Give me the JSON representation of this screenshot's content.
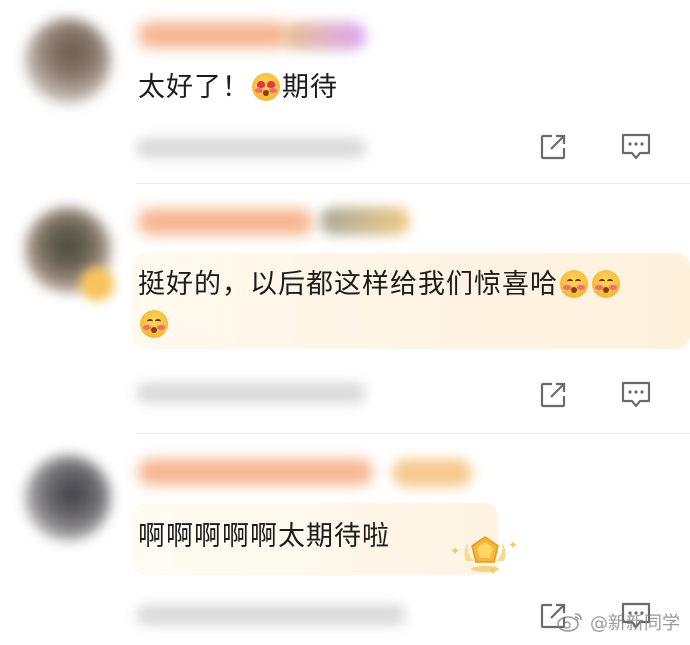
{
  "comments": [
    {
      "text": "太好了！",
      "text_after_emoji": "期待",
      "emoji": "heart-eyes-emoji"
    },
    {
      "text": "挺好的，以后都这样给我们惊喜哈",
      "emoji": "blushing-emoji"
    },
    {
      "text": "啊啊啊啊啊太期待啦",
      "badge": "fan-medal-icon"
    }
  ],
  "actions": {
    "share_icon": "share-icon",
    "reply_icon": "comment-reply-icon"
  },
  "watermark": {
    "text": "@新新同学",
    "icon": "weibo-logo-icon"
  },
  "colors": {
    "highlight_bubble": "#fff4e3",
    "icon_gray": "#6b6b6b",
    "name_blur": "#f6b58f"
  }
}
